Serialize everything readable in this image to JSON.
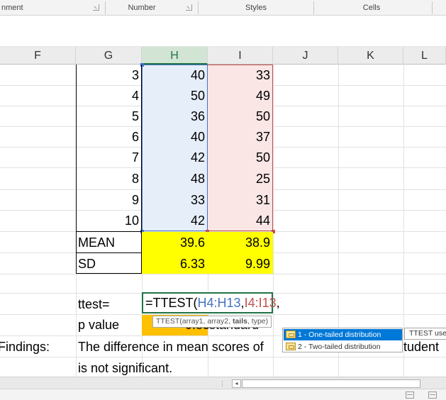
{
  "ribbon": {
    "groups": [
      "nment",
      "Number",
      "Styles",
      "Cells"
    ]
  },
  "columns": [
    "F",
    "G",
    "H",
    "I",
    "J",
    "K",
    "L"
  ],
  "selected_column": "H",
  "table": {
    "rows": [
      {
        "g": "3",
        "h": "40",
        "i": "33"
      },
      {
        "g": "4",
        "h": "50",
        "i": "49"
      },
      {
        "g": "5",
        "h": "36",
        "i": "50"
      },
      {
        "g": "6",
        "h": "40",
        "i": "37"
      },
      {
        "g": "7",
        "h": "42",
        "i": "50"
      },
      {
        "g": "8",
        "h": "48",
        "i": "25"
      },
      {
        "g": "9",
        "h": "33",
        "i": "31"
      },
      {
        "g": "10",
        "h": "42",
        "i": "44"
      }
    ],
    "mean": {
      "label": "MEAN",
      "h": "39.6",
      "i": "38.9"
    },
    "sd": {
      "label": "SD",
      "h": "6.33",
      "i": "9.99"
    }
  },
  "ttest": {
    "label": "ttest=",
    "formula_prefix": "=TTEST(",
    "range1": "H4:H13",
    "comma1": ",",
    "range2": "I4:I13",
    "comma2": ","
  },
  "pvalue": {
    "label": "p value",
    "hidden_value": "0.85",
    "hidden_text": "standard"
  },
  "tooltip": {
    "text_before": "TTEST(array1, array2, ",
    "bold_arg": "tails",
    "text_after": ", type)"
  },
  "autocomplete": {
    "items": [
      {
        "label": "1 - One-tailed distribution",
        "active": true
      },
      {
        "label": "2 - Two-tailed distribution",
        "active": false
      }
    ],
    "side_tip": "TTEST uses"
  },
  "findings": {
    "label": "Findings:",
    "line1_start": "The difference in mean scores of",
    "line1_end": "tudent",
    "line2": "is not significant."
  },
  "colors": {
    "accent_green": "#217346",
    "range1_blue": "#4472c4",
    "range2_red": "#c0504d",
    "highlight_yellow": "#ffff00",
    "highlight_orange": "#ffc000",
    "autocomplete_active": "#0078d7"
  }
}
